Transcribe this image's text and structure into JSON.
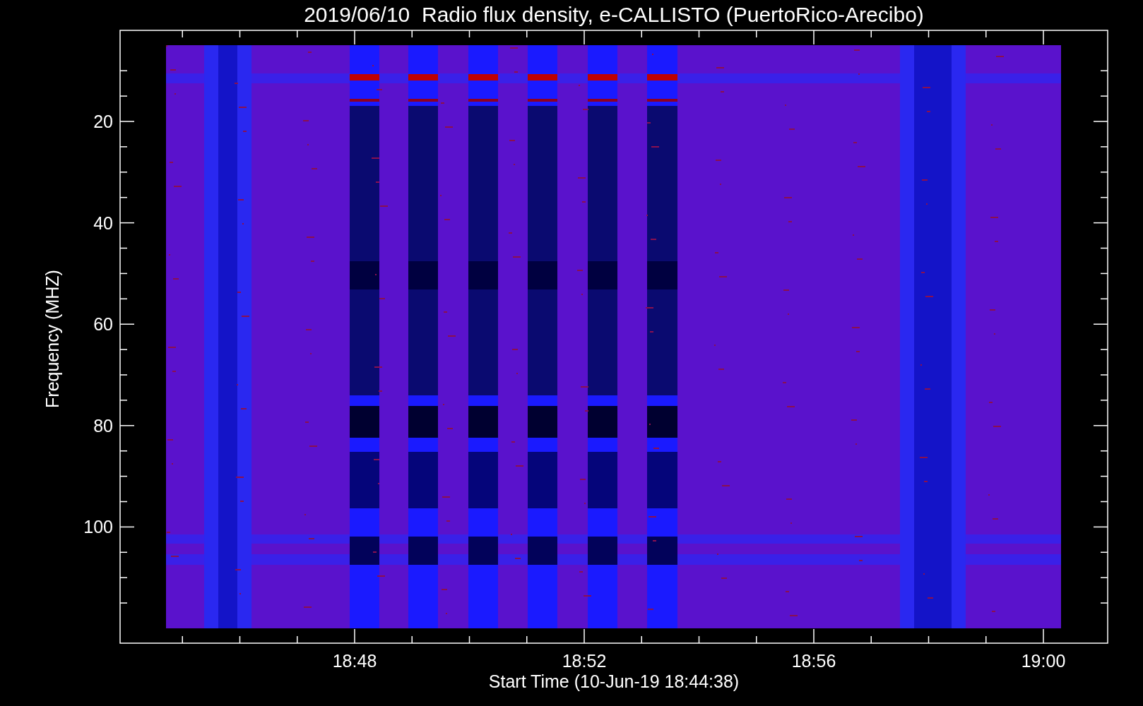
{
  "plot": {
    "title": "2019/06/10  Radio flux density, e-CALLISTO (PuertoRico-Arecibo)",
    "ylabel": "Frequency (MHZ)",
    "xlabel": "Start Time (10-Jun-19 18:44:38)",
    "yticks": [
      "20",
      "40",
      "60",
      "80",
      "100"
    ],
    "xticks": [
      "18:48",
      "18:52",
      "18:56",
      "19:00"
    ]
  }
}
